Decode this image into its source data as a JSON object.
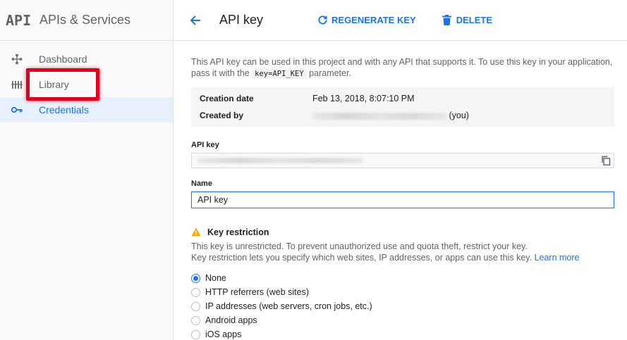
{
  "sidebar": {
    "logo": "API",
    "title": "APIs & Services",
    "items": [
      {
        "label": "Dashboard",
        "icon": "dashboard-icon"
      },
      {
        "label": "Library",
        "icon": "library-icon"
      },
      {
        "label": "Credentials",
        "icon": "key-icon",
        "active": true
      }
    ]
  },
  "toolbar": {
    "title": "API key",
    "regenerate_label": "REGENERATE KEY",
    "delete_label": "DELETE"
  },
  "main": {
    "description_part1": "This API key can be used in this project and with any API that supports it. To use this key in your application, pass it with the ",
    "description_code": "key=API_KEY",
    "description_part2": " parameter.",
    "creation_date_label": "Creation date",
    "creation_date_value": "Feb 13, 2018, 8:07:10 PM",
    "created_by_label": "Created by",
    "created_by_suffix": "(you)",
    "api_key_label": "API key",
    "name_label": "Name",
    "name_value": "API key",
    "key_restriction_title": "Key restriction",
    "key_restriction_line1": "This key is unrestricted. To prevent unauthorized use and quota theft, restrict your key.",
    "key_restriction_line2": "Key restriction lets you specify which web sites, IP addresses, or apps can use this key.",
    "learn_more": "Learn more",
    "restriction_options": [
      "None",
      "HTTP referrers (web sites)",
      "IP addresses (web servers, cron jobs, etc.)",
      "Android apps",
      "iOS apps"
    ],
    "selected_option": "None"
  },
  "colors": {
    "accent": "#1a73e8",
    "highlight": "#e0001b",
    "warning": "#f9ab00"
  }
}
